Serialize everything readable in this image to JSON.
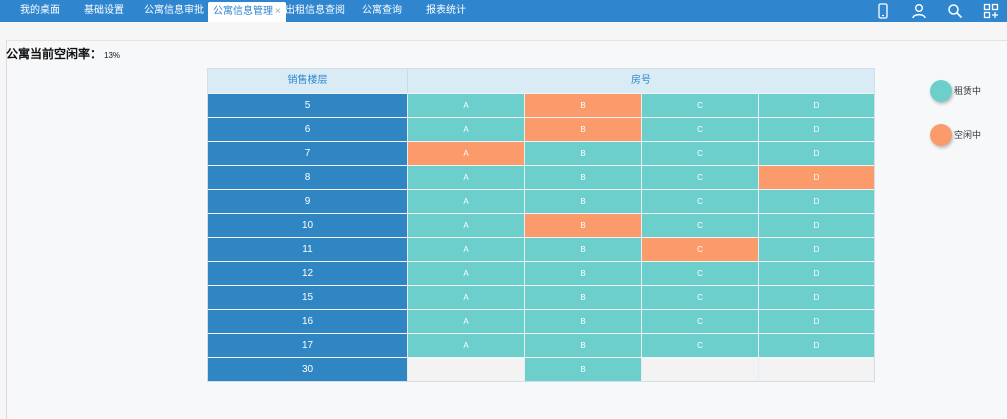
{
  "nav": {
    "tabs": [
      {
        "label": "我的桌面"
      },
      {
        "label": "基础设置"
      },
      {
        "label": "公寓信息审批"
      },
      {
        "label": "公寓信息管理",
        "close": "×"
      },
      {
        "label": "出租信息查阅"
      },
      {
        "label": "公寓查询"
      },
      {
        "label": "报表统计"
      }
    ],
    "icons": [
      "phone-icon",
      "user-icon",
      "search-icon",
      "apps-icon"
    ]
  },
  "summary": {
    "label": "公寓当前空闲率：",
    "value": "13%"
  },
  "table": {
    "headers": {
      "floor": "销售楼层",
      "room": "房号"
    },
    "rows": [
      {
        "floor": "5",
        "rooms": [
          {
            "code": "A",
            "status": "rented"
          },
          {
            "code": "B",
            "status": "vacant"
          },
          {
            "code": "C",
            "status": "rented"
          },
          {
            "code": "D",
            "status": "rented"
          }
        ]
      },
      {
        "floor": "6",
        "rooms": [
          {
            "code": "A",
            "status": "rented"
          },
          {
            "code": "B",
            "status": "vacant"
          },
          {
            "code": "C",
            "status": "rented"
          },
          {
            "code": "D",
            "status": "rented"
          }
        ]
      },
      {
        "floor": "7",
        "rooms": [
          {
            "code": "A",
            "status": "vacant"
          },
          {
            "code": "B",
            "status": "rented"
          },
          {
            "code": "C",
            "status": "rented"
          },
          {
            "code": "D",
            "status": "rented"
          }
        ]
      },
      {
        "floor": "8",
        "rooms": [
          {
            "code": "A",
            "status": "rented"
          },
          {
            "code": "B",
            "status": "rented"
          },
          {
            "code": "C",
            "status": "rented"
          },
          {
            "code": "D",
            "status": "vacant"
          }
        ]
      },
      {
        "floor": "9",
        "rooms": [
          {
            "code": "A",
            "status": "rented"
          },
          {
            "code": "B",
            "status": "rented"
          },
          {
            "code": "C",
            "status": "rented"
          },
          {
            "code": "D",
            "status": "rented"
          }
        ]
      },
      {
        "floor": "10",
        "rooms": [
          {
            "code": "A",
            "status": "rented"
          },
          {
            "code": "B",
            "status": "vacant"
          },
          {
            "code": "C",
            "status": "rented"
          },
          {
            "code": "D",
            "status": "rented"
          }
        ]
      },
      {
        "floor": "11",
        "rooms": [
          {
            "code": "A",
            "status": "rented"
          },
          {
            "code": "B",
            "status": "rented"
          },
          {
            "code": "C",
            "status": "vacant"
          },
          {
            "code": "D",
            "status": "rented"
          }
        ]
      },
      {
        "floor": "12",
        "rooms": [
          {
            "code": "A",
            "status": "rented"
          },
          {
            "code": "B",
            "status": "rented"
          },
          {
            "code": "C",
            "status": "rented"
          },
          {
            "code": "D",
            "status": "rented"
          }
        ]
      },
      {
        "floor": "15",
        "rooms": [
          {
            "code": "A",
            "status": "rented"
          },
          {
            "code": "B",
            "status": "rented"
          },
          {
            "code": "C",
            "status": "rented"
          },
          {
            "code": "D",
            "status": "rented"
          }
        ]
      },
      {
        "floor": "16",
        "rooms": [
          {
            "code": "A",
            "status": "rented"
          },
          {
            "code": "B",
            "status": "rented"
          },
          {
            "code": "C",
            "status": "rented"
          },
          {
            "code": "D",
            "status": "rented"
          }
        ]
      },
      {
        "floor": "17",
        "rooms": [
          {
            "code": "A",
            "status": "rented"
          },
          {
            "code": "B",
            "status": "rented"
          },
          {
            "code": "C",
            "status": "rented"
          },
          {
            "code": "D",
            "status": "rented"
          }
        ]
      },
      {
        "floor": "30",
        "rooms": [
          {
            "code": "",
            "status": "empty"
          },
          {
            "code": "B",
            "status": "rented"
          },
          {
            "code": "",
            "status": "empty"
          },
          {
            "code": "",
            "status": "empty"
          }
        ]
      }
    ]
  },
  "legend": [
    {
      "label": "租赁中",
      "status": "rented",
      "color": "#6ccfcb"
    },
    {
      "label": "空闲中",
      "status": "vacant",
      "color": "#fb9a6a"
    }
  ],
  "colors": {
    "accent": "#2f86cf",
    "rented": "#6ccfcb",
    "vacant": "#fb9a6a"
  }
}
